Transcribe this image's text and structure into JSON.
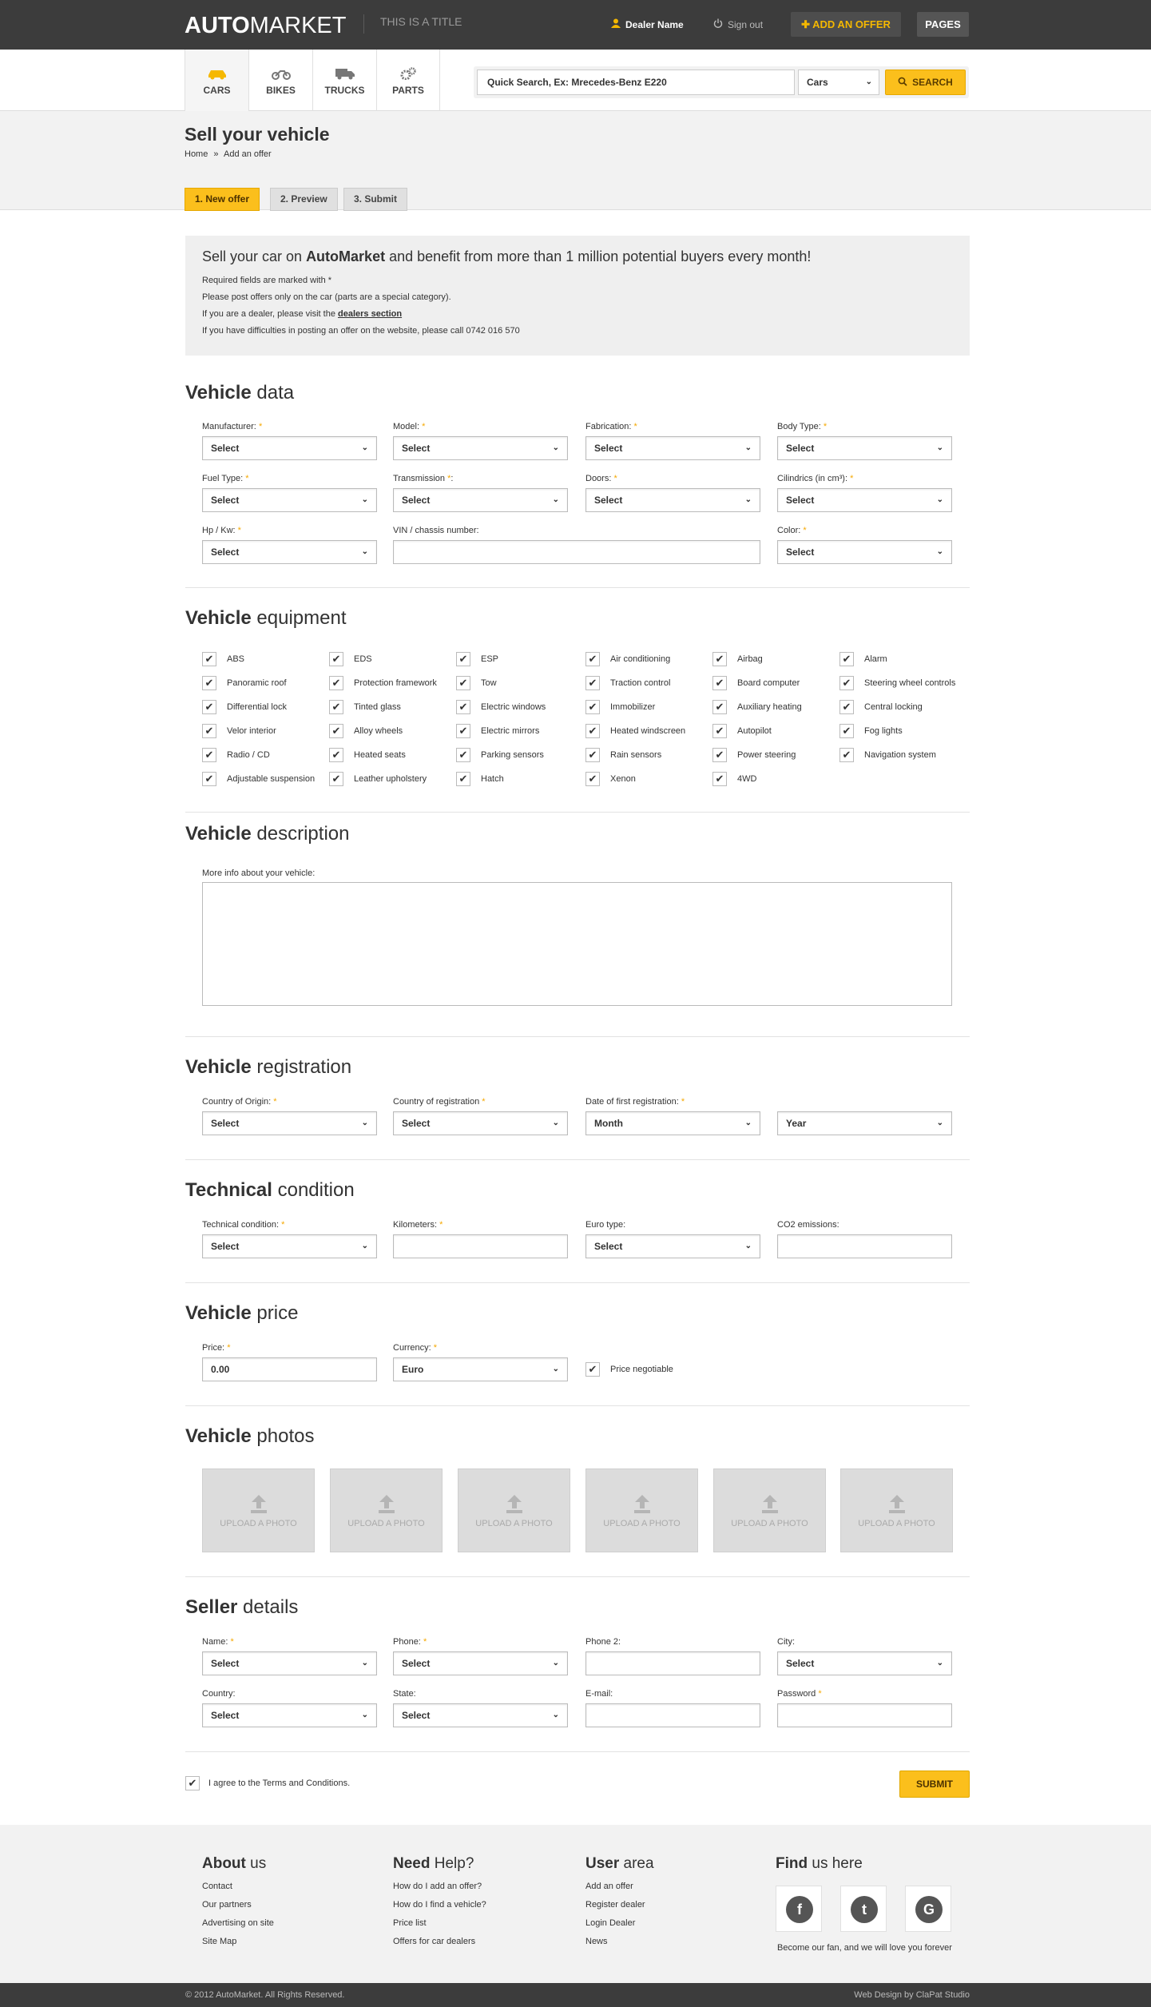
{
  "header": {
    "logo_bold": "AUTO",
    "logo_thin": "MARKET",
    "site_title": "THIS IS A TITLE",
    "dealer_name": "Dealer Name",
    "sign_out": "Sign out",
    "add_offer": "ADD AN OFFER",
    "pages": "PAGES"
  },
  "nav": {
    "tabs": [
      {
        "label": "CARS",
        "icon": "car-icon"
      },
      {
        "label": "BIKES",
        "icon": "bike-icon"
      },
      {
        "label": "TRUCKS",
        "icon": "truck-icon"
      },
      {
        "label": "PARTS",
        "icon": "gears-icon"
      }
    ],
    "search_placeholder": "Quick Search, Ex: Mrecedes-Benz E220",
    "search_category": "Cars",
    "search_button": "SEARCH"
  },
  "page": {
    "title": "Sell your vehicle",
    "breadcrumb_home": "Home",
    "breadcrumb_sep": "»",
    "breadcrumb_current": "Add an offer",
    "steps": [
      "1. New offer",
      "2. Preview",
      "3. Submit"
    ]
  },
  "intro": {
    "headline_pre": "Sell your car on ",
    "headline_brand": "AutoMarket",
    "headline_post": " and benefit from more than 1 million potential buyers every month!",
    "line1": "Required fields are marked with *",
    "line2": "Please post offers only on the car (parts are a special category).",
    "line3_pre": "If you are a dealer, please visit the ",
    "line3_link": "dealers section",
    "line4": "If you have difficulties in posting an offer on the website, please call 0742 016 570"
  },
  "select_default": "Select",
  "vehicle_data": {
    "title_bold": "Vehicle",
    "title_thin": " data",
    "labels": {
      "manufacturer": "Manufacturer:",
      "model": "Model:",
      "fabrication": "Fabrication:",
      "body_type": "Body Type:",
      "fuel_type": "Fuel Type:",
      "transmission": "Transmission",
      "transmission_suffix": ":",
      "doors": "Doors:",
      "cilindrics": "Cilindrics (in cm³):",
      "hp_kw": "Hp / Kw:",
      "vin": "VIN / chassis number:",
      "color": "Color:"
    }
  },
  "equipment": {
    "title_bold": "Vehicle",
    "title_thin": " equipment",
    "columns": [
      [
        "ABS",
        "Panoramic roof",
        "Differential lock",
        "Velor interior",
        "Radio / CD",
        "Adjustable suspension"
      ],
      [
        "EDS",
        "Protection framework",
        "Tinted glass",
        "Alloy wheels",
        "Heated seats",
        "Leather upholstery"
      ],
      [
        "ESP",
        "Tow",
        "Electric windows",
        "Electric mirrors",
        "Parking sensors",
        "Hatch"
      ],
      [
        "Air conditioning",
        "Traction control",
        "Immobilizer",
        "Heated windscreen",
        "Rain sensors",
        "Xenon"
      ],
      [
        "Airbag",
        "Board computer",
        "Auxiliary heating",
        "Autopilot",
        "Power steering",
        "4WD"
      ],
      [
        "Alarm",
        "Steering wheel controls",
        "Central locking",
        "Fog lights",
        "Navigation system"
      ]
    ]
  },
  "description": {
    "title_bold": "Vehicle",
    "title_thin": " description",
    "label": "More info about your vehicle:"
  },
  "registration": {
    "title_bold": "Vehicle",
    "title_thin": " registration",
    "country_origin": "Country of Origin:",
    "country_reg": "Country of registration",
    "first_reg": "Date of first registration:",
    "month": "Month",
    "year": "Year"
  },
  "technical": {
    "title_bold": "Technical",
    "title_thin": " condition",
    "condition": "Technical condition:",
    "kilometers": "Kilometers:",
    "euro_type": "Euro type:",
    "co2": "CO2 emissions:"
  },
  "price": {
    "title_bold": "Vehicle",
    "title_thin": " price",
    "price_label": "Price:",
    "price_value": "0.00",
    "currency_label": "Currency:",
    "currency_value": "Euro",
    "negotiable": "Price negotiable"
  },
  "photos": {
    "title_bold": "Vehicle",
    "title_thin": " photos",
    "upload_label": "UPLOAD A PHOTO"
  },
  "seller": {
    "title_bold": "Seller",
    "title_thin": " details",
    "name": "Name:",
    "phone": "Phone:",
    "phone2": "Phone 2:",
    "city": "City:",
    "country": "Country:",
    "state": "State:",
    "email": "E-mail:",
    "password": "Password"
  },
  "agree": "I agree to the Terms and Conditions.",
  "submit": "SUBMIT",
  "required_mark": "*",
  "footer": {
    "about_bold": "About",
    "about_thin": " us",
    "about_links": [
      "Contact",
      "Our partners",
      "Advertising on site",
      "Site Map"
    ],
    "help_bold": "Need",
    "help_thin": " Help?",
    "help_links": [
      "How do I add an offer?",
      "How do I find a vehicle?",
      "Price list",
      "Offers for car dealers"
    ],
    "user_bold": "User",
    "user_thin": " area",
    "user_links": [
      "Add an offer",
      "Register dealer",
      "Login Dealer",
      "News"
    ],
    "find_bold": "Find",
    "find_thin": " us here",
    "fan_text": "Become our fan, and we will love you forever",
    "copyright": "© 2012 AutoMarket. All Rights Reserved.",
    "credit": "Web Design by ClaPat Studio"
  },
  "colors": {
    "accent": "#fbbf1c",
    "topbar": "#3c3c3c",
    "panel": "#f2f2f2"
  }
}
